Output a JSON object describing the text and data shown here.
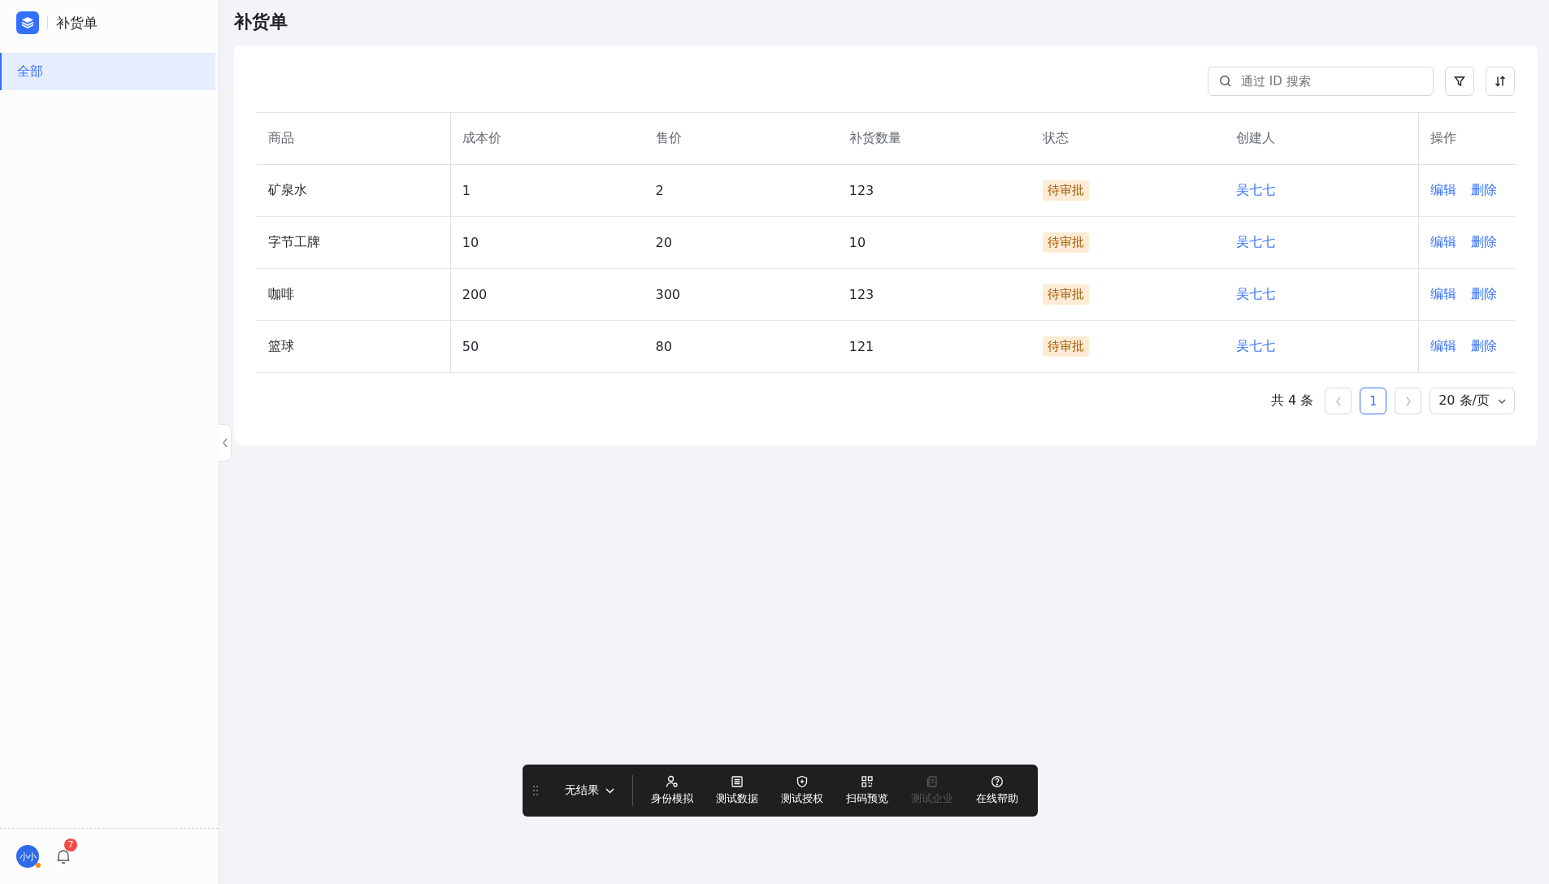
{
  "sidebar": {
    "app_title": "补货单",
    "items": [
      {
        "label": "全部",
        "selected": true
      }
    ],
    "avatar": {
      "text": "小小"
    },
    "notifications": {
      "count": "7"
    }
  },
  "page": {
    "title": "补货单"
  },
  "search": {
    "placeholder": "通过 ID 搜索"
  },
  "table": {
    "columns": [
      "商品",
      "成本价",
      "售价",
      "补货数量",
      "状态",
      "创建人",
      "操作"
    ],
    "rows": [
      {
        "product": "矿泉水",
        "cost": "1",
        "price": "2",
        "quantity": "123",
        "status": "待审批",
        "creator": "吴七七",
        "actions": [
          "编辑",
          "删除"
        ]
      },
      {
        "product": "字节工牌",
        "cost": "10",
        "price": "20",
        "quantity": "10",
        "status": "待审批",
        "creator": "吴七七",
        "actions": [
          "编辑",
          "删除"
        ]
      },
      {
        "product": "咖啡",
        "cost": "200",
        "price": "300",
        "quantity": "123",
        "status": "待审批",
        "creator": "吴七七",
        "actions": [
          "编辑",
          "删除"
        ]
      },
      {
        "product": "篮球",
        "cost": "50",
        "price": "80",
        "quantity": "121",
        "status": "待审批",
        "creator": "吴七七",
        "actions": [
          "编辑",
          "删除"
        ]
      }
    ]
  },
  "pagination": {
    "total": "共 4 条",
    "pages": [
      {
        "label": "1",
        "selected": true
      }
    ],
    "page_size": "20 条/页"
  },
  "dev_toolbar": {
    "result": "无结果",
    "tools": [
      {
        "label": "身份模拟",
        "kind": "user",
        "disabled": false
      },
      {
        "label": "测试数据",
        "kind": "table",
        "disabled": false
      },
      {
        "label": "测试授权",
        "kind": "shield",
        "disabled": false
      },
      {
        "label": "扫码预览",
        "kind": "qr",
        "disabled": false
      },
      {
        "label": "测试企业",
        "kind": "building",
        "disabled": true
      },
      {
        "label": "在线帮助",
        "kind": "help",
        "disabled": false
      }
    ]
  }
}
